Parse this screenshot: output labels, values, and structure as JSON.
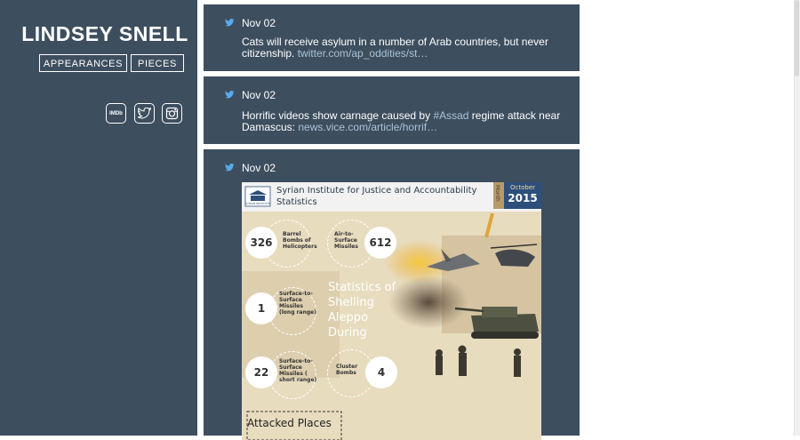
{
  "site": {
    "title": "LINDSEY SNELL",
    "nav": {
      "appearances": "APPEARANCES",
      "pieces": "PIECES"
    },
    "social": {
      "imdb_label": "IMDb"
    }
  },
  "feed": [
    {
      "date": "Nov 02",
      "text": "Cats will receive asylum in a number of Arab countries, but never citizenship. ",
      "link": "twitter.com/ap_oddities/st…"
    },
    {
      "date": "Nov 02",
      "text_before": "Horrific videos show carnage caused by ",
      "hashtag": "#Assad",
      "text_after": " regime attack near Damascus: ",
      "link": "news.vice.com/article/horrif…"
    },
    {
      "date": "Nov 02"
    }
  ],
  "infographic": {
    "header": "Syrian Institute for Justice and Accountability\nStatistics",
    "logo_text": "SYRIAN INSTITUTE",
    "month": "October",
    "year": "2015",
    "side_label": "Month",
    "heading": "Statistics of Shelling Aleppo During",
    "stats": [
      {
        "value": "326",
        "label": "Barrel Bombs of Helicopters"
      },
      {
        "value": "612",
        "label": "Air-to-Surface Missiles"
      },
      {
        "value": "1",
        "label": "Surface-to-Surface Missiles (long range)"
      },
      {
        "value": "22",
        "label": "Surface-to-Surface Missiles ( short range)"
      },
      {
        "value": "4",
        "label": "Cluster Bombs"
      }
    ],
    "attacked": "Attacked Places"
  },
  "colors": {
    "panel": "#3d4e5e",
    "twitter": "#55acee",
    "link": "#a9c3d8"
  }
}
